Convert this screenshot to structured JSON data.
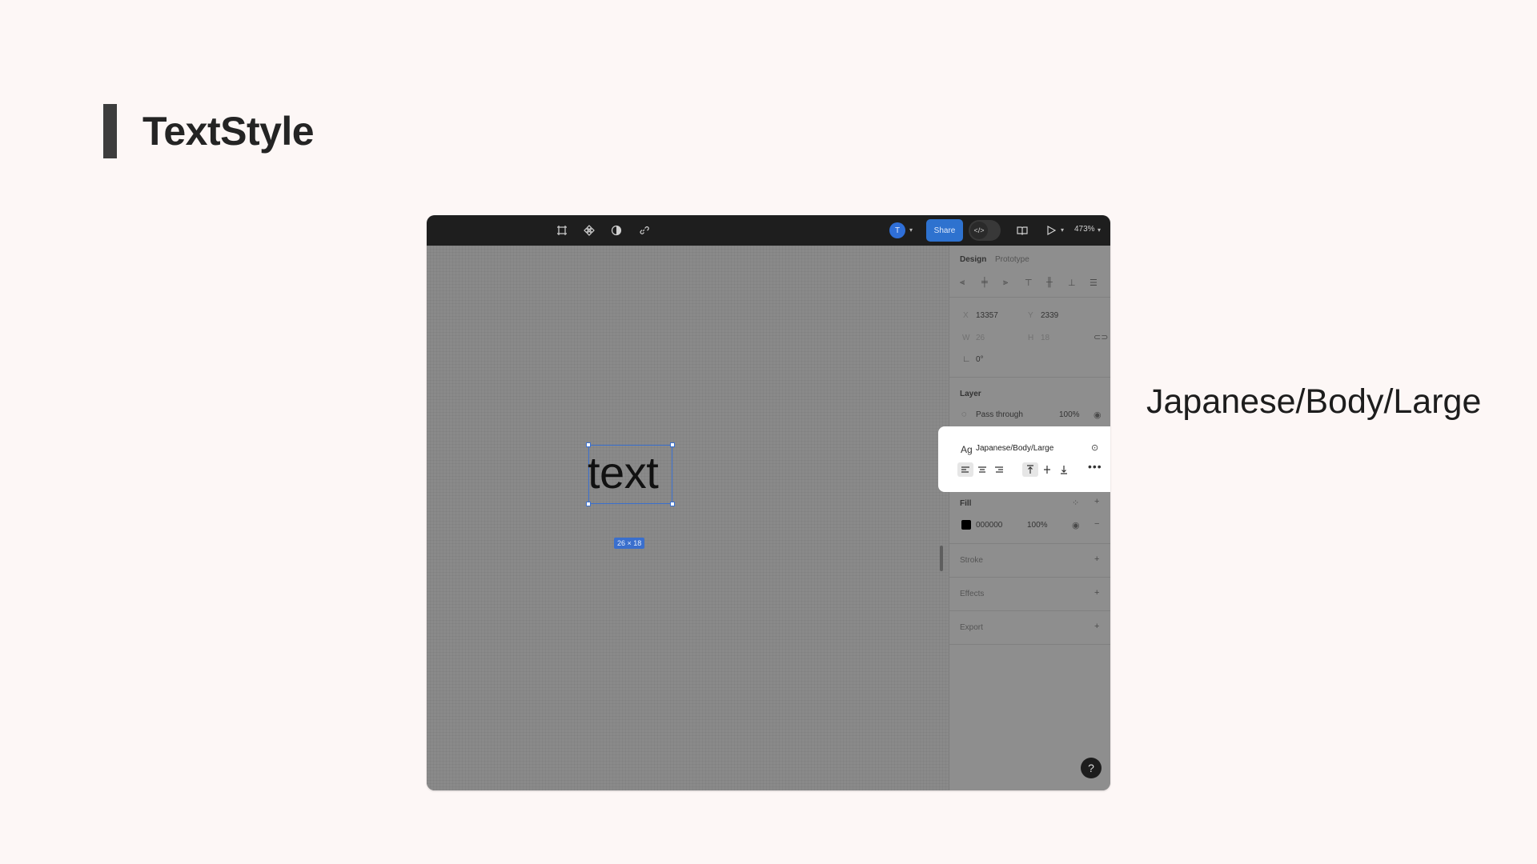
{
  "slide": {
    "title": "TextStyle",
    "callout_label": "Japanese/Body/Large"
  },
  "toolbar": {
    "avatar_initial": "T",
    "share_label": "Share",
    "zoom_level": "473%"
  },
  "canvas": {
    "text_layer_content": "text",
    "size_badge": "26 × 18"
  },
  "design_panel": {
    "tabs": {
      "design": "Design",
      "prototype": "Prototype"
    },
    "position": {
      "x_label": "X",
      "x_value": "13357",
      "y_label": "Y",
      "y_value": "2339"
    },
    "size": {
      "w_label": "W",
      "w_value": "26",
      "h_label": "H",
      "h_value": "18"
    },
    "rotation": "0°",
    "layer": {
      "heading": "Layer",
      "blend_mode": "Pass through",
      "opacity": "100%"
    },
    "text_style": {
      "ag": "Ag",
      "name": "Japanese/Body/Large"
    },
    "fill": {
      "heading": "Fill",
      "hex": "000000",
      "opacity": "100%",
      "swatch_color": "#000000"
    },
    "stroke": {
      "heading": "Stroke"
    },
    "effects": {
      "heading": "Effects"
    },
    "export": {
      "heading": "Export"
    }
  },
  "help": {
    "label": "?"
  },
  "colors": {
    "accent": "#2e72cf",
    "selection": "#3a6fcd",
    "toolbar_bg": "#1e1e1e",
    "page_bg": "#fdf7f6"
  }
}
